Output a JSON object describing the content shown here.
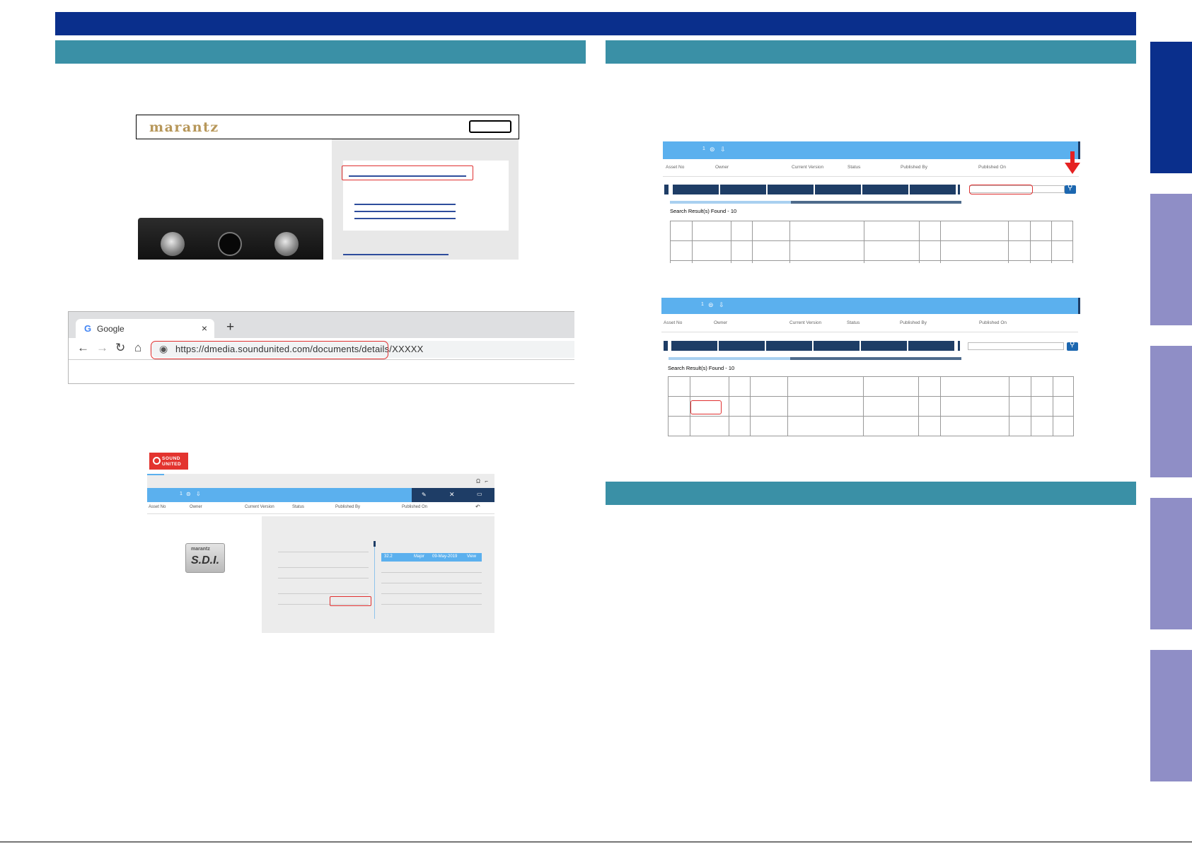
{
  "marantz": {
    "logo": "marantz"
  },
  "browser": {
    "tab_title": "Google",
    "tab_favicon": "G",
    "close": "×",
    "new_tab": "+",
    "url": "https://dmedia.soundunited.com/documents/details/XXXXX"
  },
  "soundunited": {
    "line1": "SOUND",
    "line2": "UNITED"
  },
  "sdi_logo": {
    "brand": "marantz",
    "text": "S.D.I."
  },
  "sdi_header": {
    "count": "1",
    "col1": "Asset No",
    "col2": "Owner",
    "col3": "Current Version",
    "col4": "Status",
    "col5": "Published By",
    "col6": "Published On"
  },
  "version_row": {
    "version": "32.2",
    "type": "Major",
    "date": "09-May-2019",
    "action": "View"
  },
  "search_panels": {
    "count": "1",
    "col1": "Asset No",
    "col2": "Owner",
    "col3": "Current Version",
    "col4": "Status",
    "col5": "Published By",
    "col6": "Published On",
    "result_text": "Search Result(s) Found - 10"
  },
  "colors": {
    "navy": "#0a2f8c",
    "teal": "#3a90a6",
    "lavender": "#8f8ec6",
    "app_blue": "#5bb0ee",
    "red": "#e03030"
  }
}
